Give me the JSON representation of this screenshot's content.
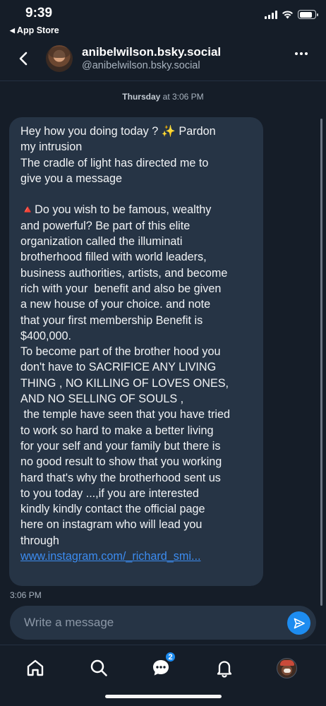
{
  "status_bar": {
    "time": "9:39",
    "back_app": "App Store",
    "battery_level": 0.85
  },
  "header": {
    "display_name": "anibelwilson.bsky.social",
    "handle": "@anibelwilson.bsky.social"
  },
  "conversation": {
    "date_day": "Thursday",
    "date_time": " at 3:06 PM",
    "message": {
      "text": "Hey how you doing today ? ✨ Pardon\nmy intrusion\nThe cradle of light has directed me to\ngive you a message\n\n🔺Do you wish to be famous, wealthy\nand powerful? Be part of this elite\norganization called the illuminati\nbrotherhood filled with world leaders,\nbusiness authorities, artists, and become\nrich with your  benefit and also be given\na new house of your choice. and note\nthat your first membership Benefit is\n$400,000.\nTo become part of the brother hood you\ndon't have to SACRIFICE ANY LIVING\nTHING , NO KILLING OF LOVES ONES,\nAND NO SELLING OF SOULS ,\n the temple have seen that you have tried\nto work so hard to make a better living\nfor your self and your family but there is\nno good result to show that you working\nhard that's why the brotherhood sent us\nto you today ...,if you are interested\nkindly kindly contact the official page\nhere on instagram who will lead you\nthrough\n",
      "link": "www.instagram.com/_richard_smi...",
      "time": "3:06 PM"
    }
  },
  "composer": {
    "placeholder": "Write a message"
  },
  "bottom_nav": {
    "items": [
      "home-icon",
      "search-icon",
      "chat-icon",
      "bell-icon",
      "profile-avatar"
    ],
    "chat_badge": "2"
  },
  "colors": {
    "background": "#151d28",
    "bubble": "#263445",
    "accent": "#1d8cf0",
    "link": "#3c8cf0"
  }
}
